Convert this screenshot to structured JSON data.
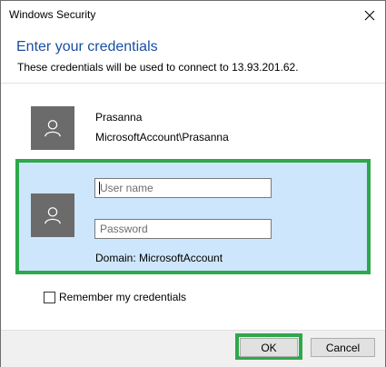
{
  "window": {
    "title": "Windows Security",
    "heading": "Enter your credentials",
    "subheading": "These credentials will be used to connect to 13.93.201.62."
  },
  "account": {
    "name": "Prasanna",
    "id": "MicrosoftAccount\\Prasanna",
    "avatar_icon": "user-silhouette-icon"
  },
  "form": {
    "username_placeholder": "User name",
    "username_value": "",
    "password_placeholder": "Password",
    "password_value": "",
    "domain_text": "Domain: MicrosoftAccount",
    "remember_label": "Remember my credentials",
    "remember_checked": false
  },
  "buttons": {
    "ok_label": "OK",
    "cancel_label": "Cancel"
  },
  "colors": {
    "heading": "#1a4fa0",
    "selection_bg": "#cde6fb",
    "highlight_outline": "#2ea84b",
    "avatar_bg": "#6b6b6b"
  }
}
